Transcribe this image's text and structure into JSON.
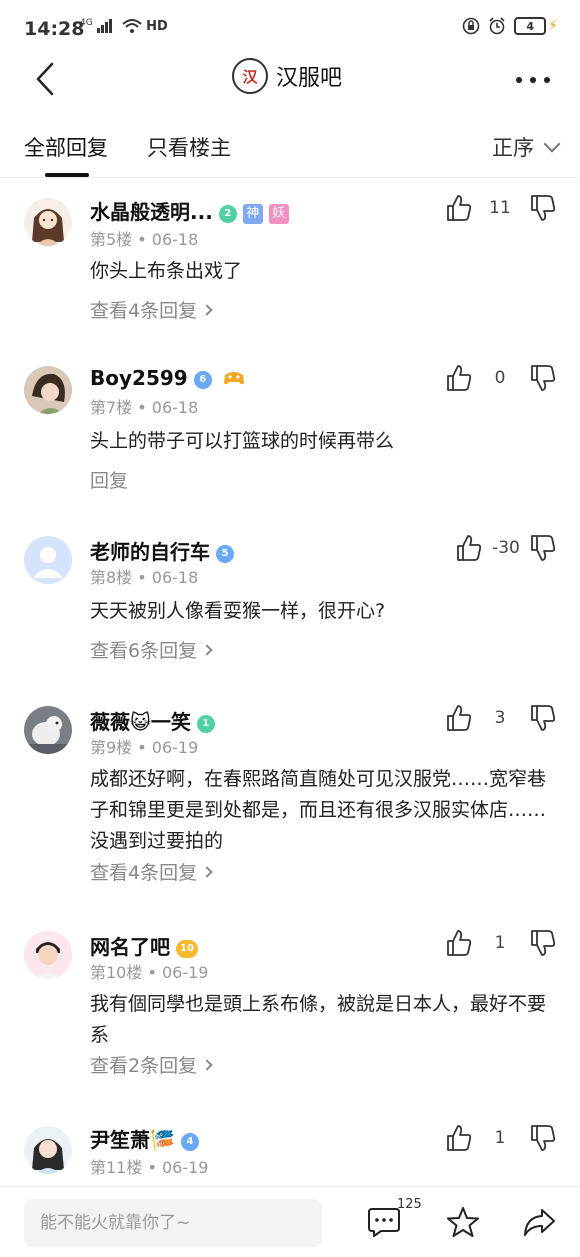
{
  "status": {
    "time": "14:28",
    "network": "4G",
    "wifi_label": "HD",
    "battery": "4"
  },
  "header": {
    "logo_text": "汉",
    "title": "汉服吧"
  },
  "tabs": {
    "all": "全部回复",
    "owner": "只看楼主",
    "sort": "正序"
  },
  "posts": [
    {
      "name": "水晶般透明...",
      "level": "2",
      "tags": [
        "神",
        "妖"
      ],
      "floor": "第5楼",
      "date": "06-18",
      "content": "你头上布条出戏了",
      "replies": "查看4条回复",
      "likes": "11"
    },
    {
      "name": "Boy2599",
      "level": "6",
      "floor": "第7楼",
      "date": "06-18",
      "content": "头上的带子可以打篮球的时候再带么",
      "replies": "回复",
      "likes": "0"
    },
    {
      "name": "老师的自行车",
      "level": "5",
      "floor": "第8楼",
      "date": "06-18",
      "content": "天天被别人像看耍猴一样，很开心?",
      "replies": "查看6条回复",
      "likes": "-30"
    },
    {
      "name": "薇薇😺一笑",
      "level": "1",
      "floor": "第9楼",
      "date": "06-19",
      "content": "成都还好啊，在春熙路简直随处可见汉服党……宽窄巷子和锦里更是到处都是，而且还有很多汉服实体店……没遇到过要拍的",
      "replies": "查看4条回复",
      "likes": "3"
    },
    {
      "name": "网名了吧",
      "level": "10",
      "floor": "第10楼",
      "date": "06-19",
      "content": "我有個同學也是頭上系布條，被說是日本人，最好不要系",
      "replies": "查看2条回复",
      "likes": "1"
    },
    {
      "name": "尹笙萧🎏",
      "level": "4",
      "floor": "第11楼",
      "date": "06-19",
      "likes": "1"
    }
  ],
  "bottom": {
    "placeholder": "能不能火就靠你了~",
    "comment_count": "125"
  },
  "colors": {
    "level_green": "#4fd1a5",
    "level_blue": "#6aa9f5",
    "level_gold": "#f5b82e",
    "tag_blue": "#7fa8f0",
    "tag_pink": "#f08fc0"
  }
}
